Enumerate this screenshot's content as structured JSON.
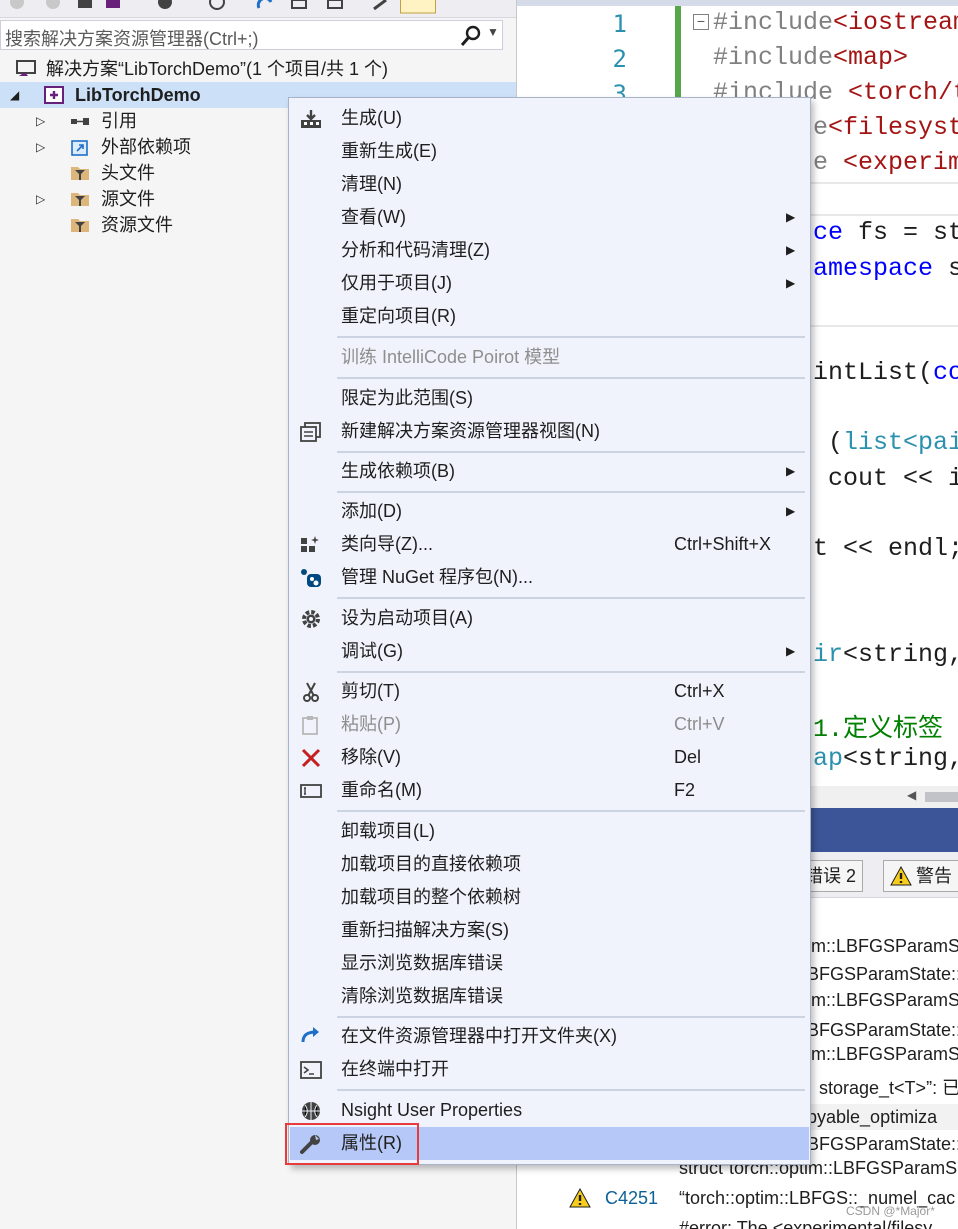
{
  "solution_explorer": {
    "search_placeholder": "搜索解决方案资源管理器(Ctrl+;)",
    "solution_label": "解决方案“LibTorchDemo”(1 个项目/共 1 个)",
    "project_label": "LibTorchDemo",
    "nodes": [
      {
        "label": "引用",
        "icon": "references-icon"
      },
      {
        "label": "外部依赖项",
        "icon": "external-dependencies-icon"
      },
      {
        "label": "头文件",
        "icon": "filter-folder-icon"
      },
      {
        "label": "源文件",
        "icon": "filter-folder-icon"
      },
      {
        "label": "资源文件",
        "icon": "filter-folder-icon"
      }
    ]
  },
  "editor": {
    "line_numbers": [
      "1",
      "2",
      "3"
    ],
    "lines": {
      "l1_directive": "#include",
      "l1_header": "<iostream>",
      "l2_directive": "#include",
      "l2_header": "<map>",
      "l3_directive": "#include",
      "l3_header": " <torch/to",
      "l4_tail": "e",
      "l4_header": "<filesyste",
      "l5_tail": "e",
      "l5_header": " <experime",
      "l6_kw": "ce",
      "l6_rest": " fs = std",
      "l7_kw": "amespace",
      "l7_rest": " st",
      "l8_fn": "intList",
      "l8_paren": "(",
      "l8_kw": "con",
      "l9_open": " (",
      "l9_ty": "list",
      "l9_rest": "<pai",
      "l10_text": " cout << i",
      "l11_text": "t << endl;",
      "l12_ty": "ir",
      "l12_rest": "<string,",
      "l13_comment": "1.定义标签",
      "l14_ty": "ap",
      "l14_rest": "<string,"
    }
  },
  "error_list": {
    "error_filter": "错误 2",
    "warning_filter": "警告",
    "rows": [
      "im::LBFGSParamS",
      "BFGSParamState::",
      "im::LBFGSParamS",
      "BFGSParamState::",
      "im::LBFGSParamS",
      "storage_t<T>”: 已",
      "pyable_optimiza",
      "BFGSParamState::",
      "struct“torch::optim::LBFGSParamS",
      "“torch::optim::LBFGS::_numel_cac",
      "#error:  The <experimental/filesy"
    ],
    "warning_code": "C4251",
    "watermark": "CSDN @*Major*"
  },
  "context_menu": {
    "items": {
      "build": {
        "label": "生成(U)"
      },
      "rebuild": {
        "label": "重新生成(E)"
      },
      "clean": {
        "label": "清理(N)"
      },
      "view": {
        "label": "查看(W)"
      },
      "analyze": {
        "label": "分析和代码清理(Z)"
      },
      "project_only": {
        "label": "仅用于项目(J)"
      },
      "retarget": {
        "label": "重定向项目(R)"
      },
      "intellicode": {
        "label": "训练 IntelliCode Poirot 模型"
      },
      "scope": {
        "label": "限定为此范围(S)"
      },
      "new_view": {
        "label": "新建解决方案资源管理器视图(N)"
      },
      "build_deps": {
        "label": "生成依赖项(B)"
      },
      "add": {
        "label": "添加(D)"
      },
      "class_wizard": {
        "label": "类向导(Z)...",
        "shortcut": "Ctrl+Shift+X"
      },
      "nuget": {
        "label": "管理 NuGet 程序包(N)..."
      },
      "startup": {
        "label": "设为启动项目(A)"
      },
      "debug": {
        "label": "调试(G)"
      },
      "cut": {
        "label": "剪切(T)",
        "shortcut": "Ctrl+X"
      },
      "paste": {
        "label": "粘贴(P)",
        "shortcut": "Ctrl+V"
      },
      "remove": {
        "label": "移除(V)",
        "shortcut": "Del"
      },
      "rename": {
        "label": "重命名(M)",
        "shortcut": "F2"
      },
      "unload": {
        "label": "卸载项目(L)"
      },
      "load_direct": {
        "label": "加载项目的直接依赖项"
      },
      "load_tree": {
        "label": "加载项目的整个依赖树"
      },
      "rescan": {
        "label": "重新扫描解决方案(S)"
      },
      "show_db_errors": {
        "label": "显示浏览数据库错误"
      },
      "clear_db_errors": {
        "label": "清除浏览数据库错误"
      },
      "open_folder": {
        "label": "在文件资源管理器中打开文件夹(X)"
      },
      "open_terminal": {
        "label": "在终端中打开"
      },
      "nsight": {
        "label": "Nsight User Properties"
      },
      "properties": {
        "label": "属性(R)"
      }
    }
  },
  "colors": {
    "menu_background": "#f0f3fb",
    "menu_highlight": "#b6c8f7",
    "highlight_frame": "#e83b3b",
    "selection": "#cce0f8",
    "error_list_title": "#3b5598"
  }
}
